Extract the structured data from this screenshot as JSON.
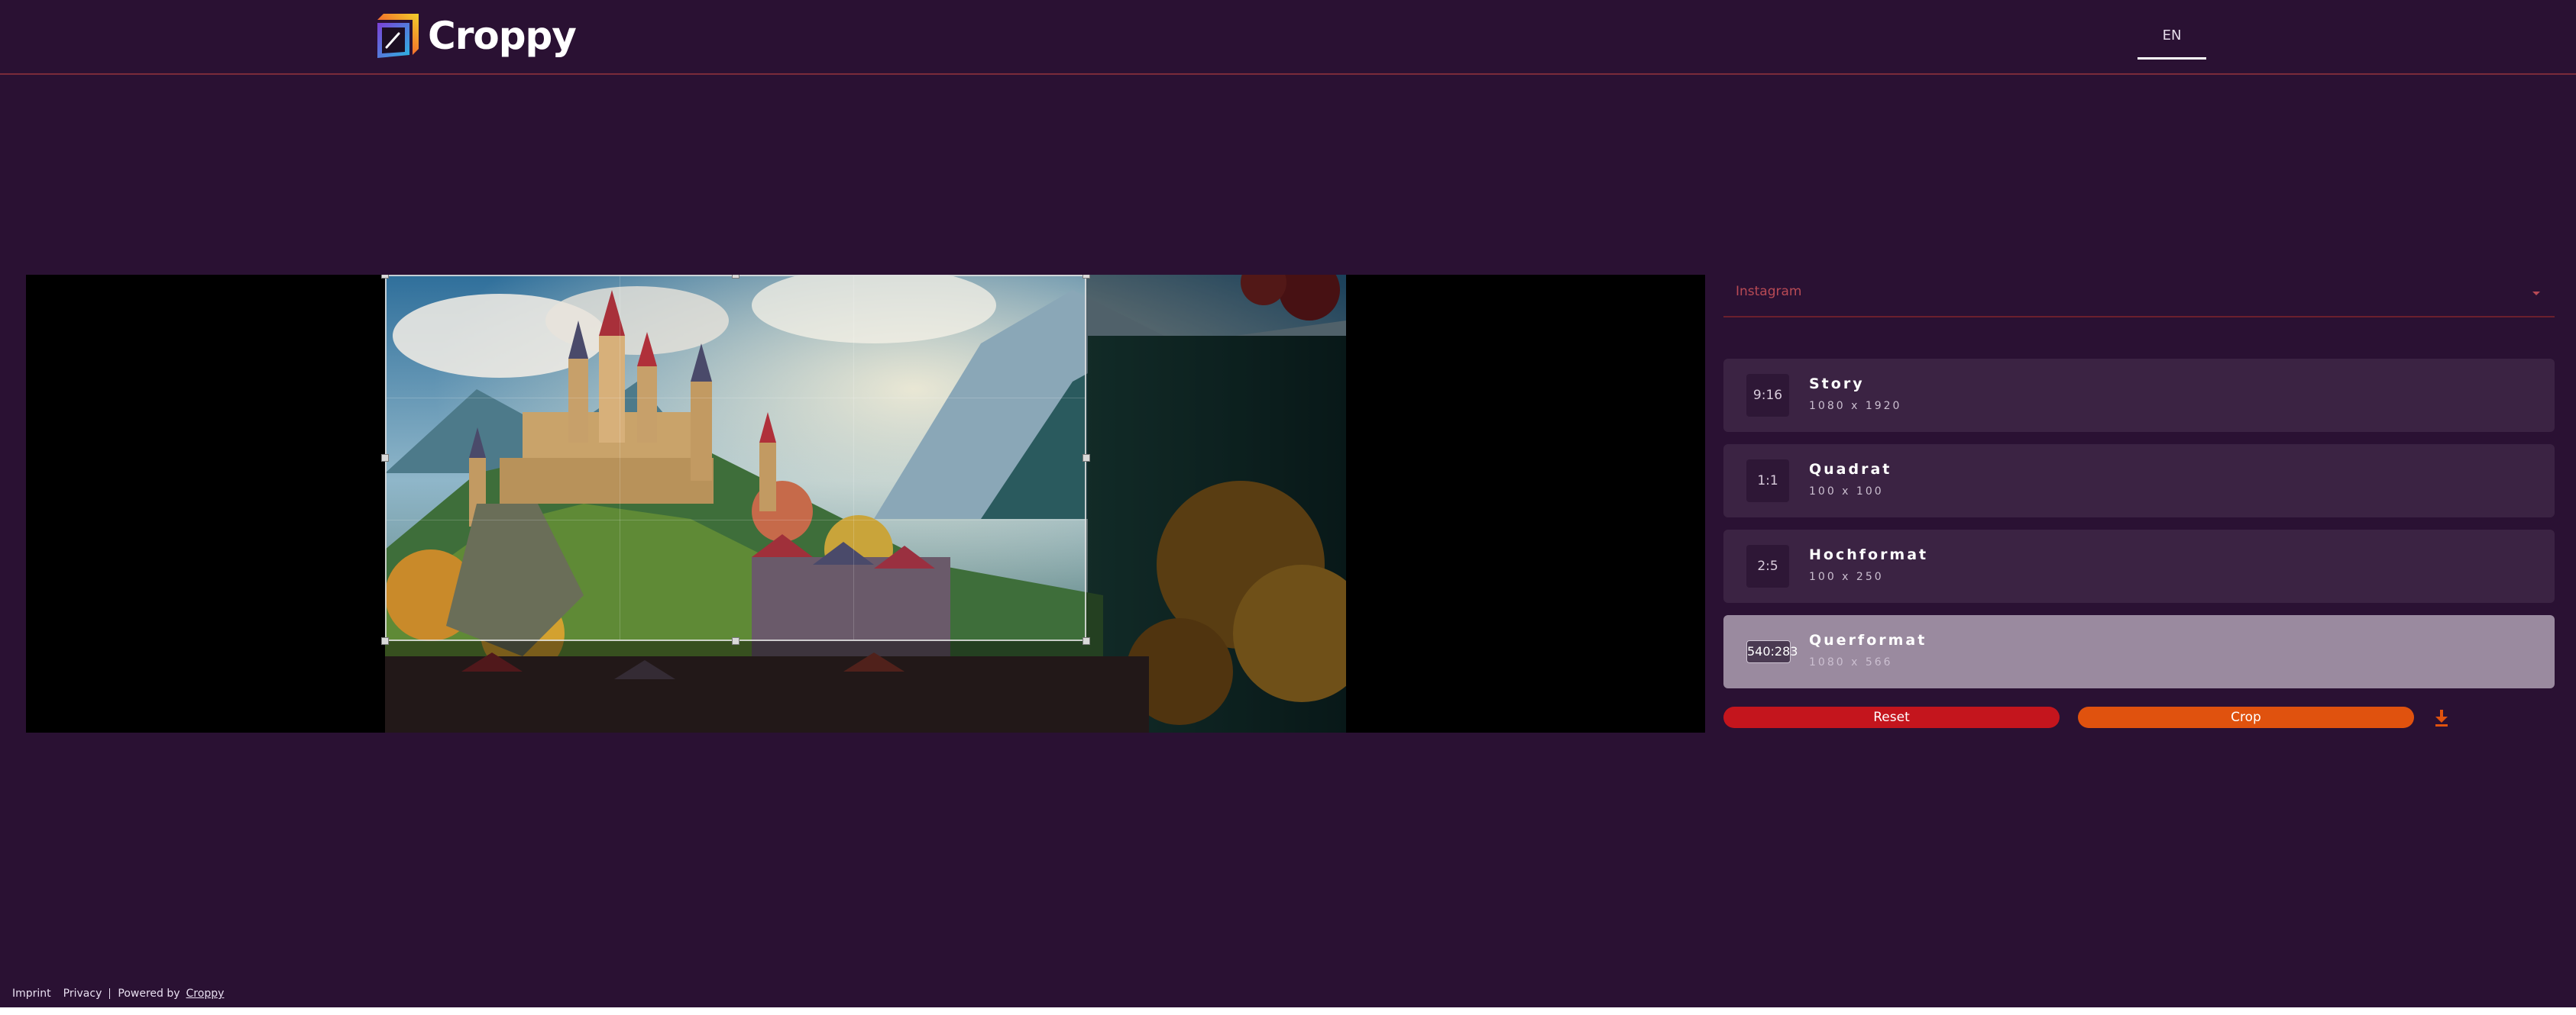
{
  "app": {
    "name": "Croppy",
    "language": "EN"
  },
  "editor": {
    "image_alt": "Fantasy castle on a wooded hill above a village in autumn"
  },
  "panel": {
    "platform": "Instagram",
    "presets": [
      {
        "ratio": "9:16",
        "title": "Story",
        "size": "1080 x 1920",
        "active": false
      },
      {
        "ratio": "1:1",
        "title": "Quadrat",
        "size": "100 x 100",
        "active": false
      },
      {
        "ratio": "2:5",
        "title": "Hochformat",
        "size": "100 x 250",
        "active": false
      },
      {
        "ratio": "540:283",
        "title": "Querformat",
        "size": "1080 x 566",
        "active": true
      }
    ],
    "reset_label": "Reset",
    "crop_label": "Crop"
  },
  "footer": {
    "imprint": "Imprint",
    "privacy": "Privacy",
    "powered_by": "Powered by",
    "powered_link": "Croppy"
  },
  "colors": {
    "background": "#2a1133",
    "reset": "#c4151d",
    "crop": "#e0520e",
    "accent_line": "#7a2b3a",
    "active_preset": "#9a8a9f"
  },
  "icons": {
    "select": "chevron-down-icon",
    "download": "download-icon",
    "logo": "croppy-logo-icon"
  }
}
